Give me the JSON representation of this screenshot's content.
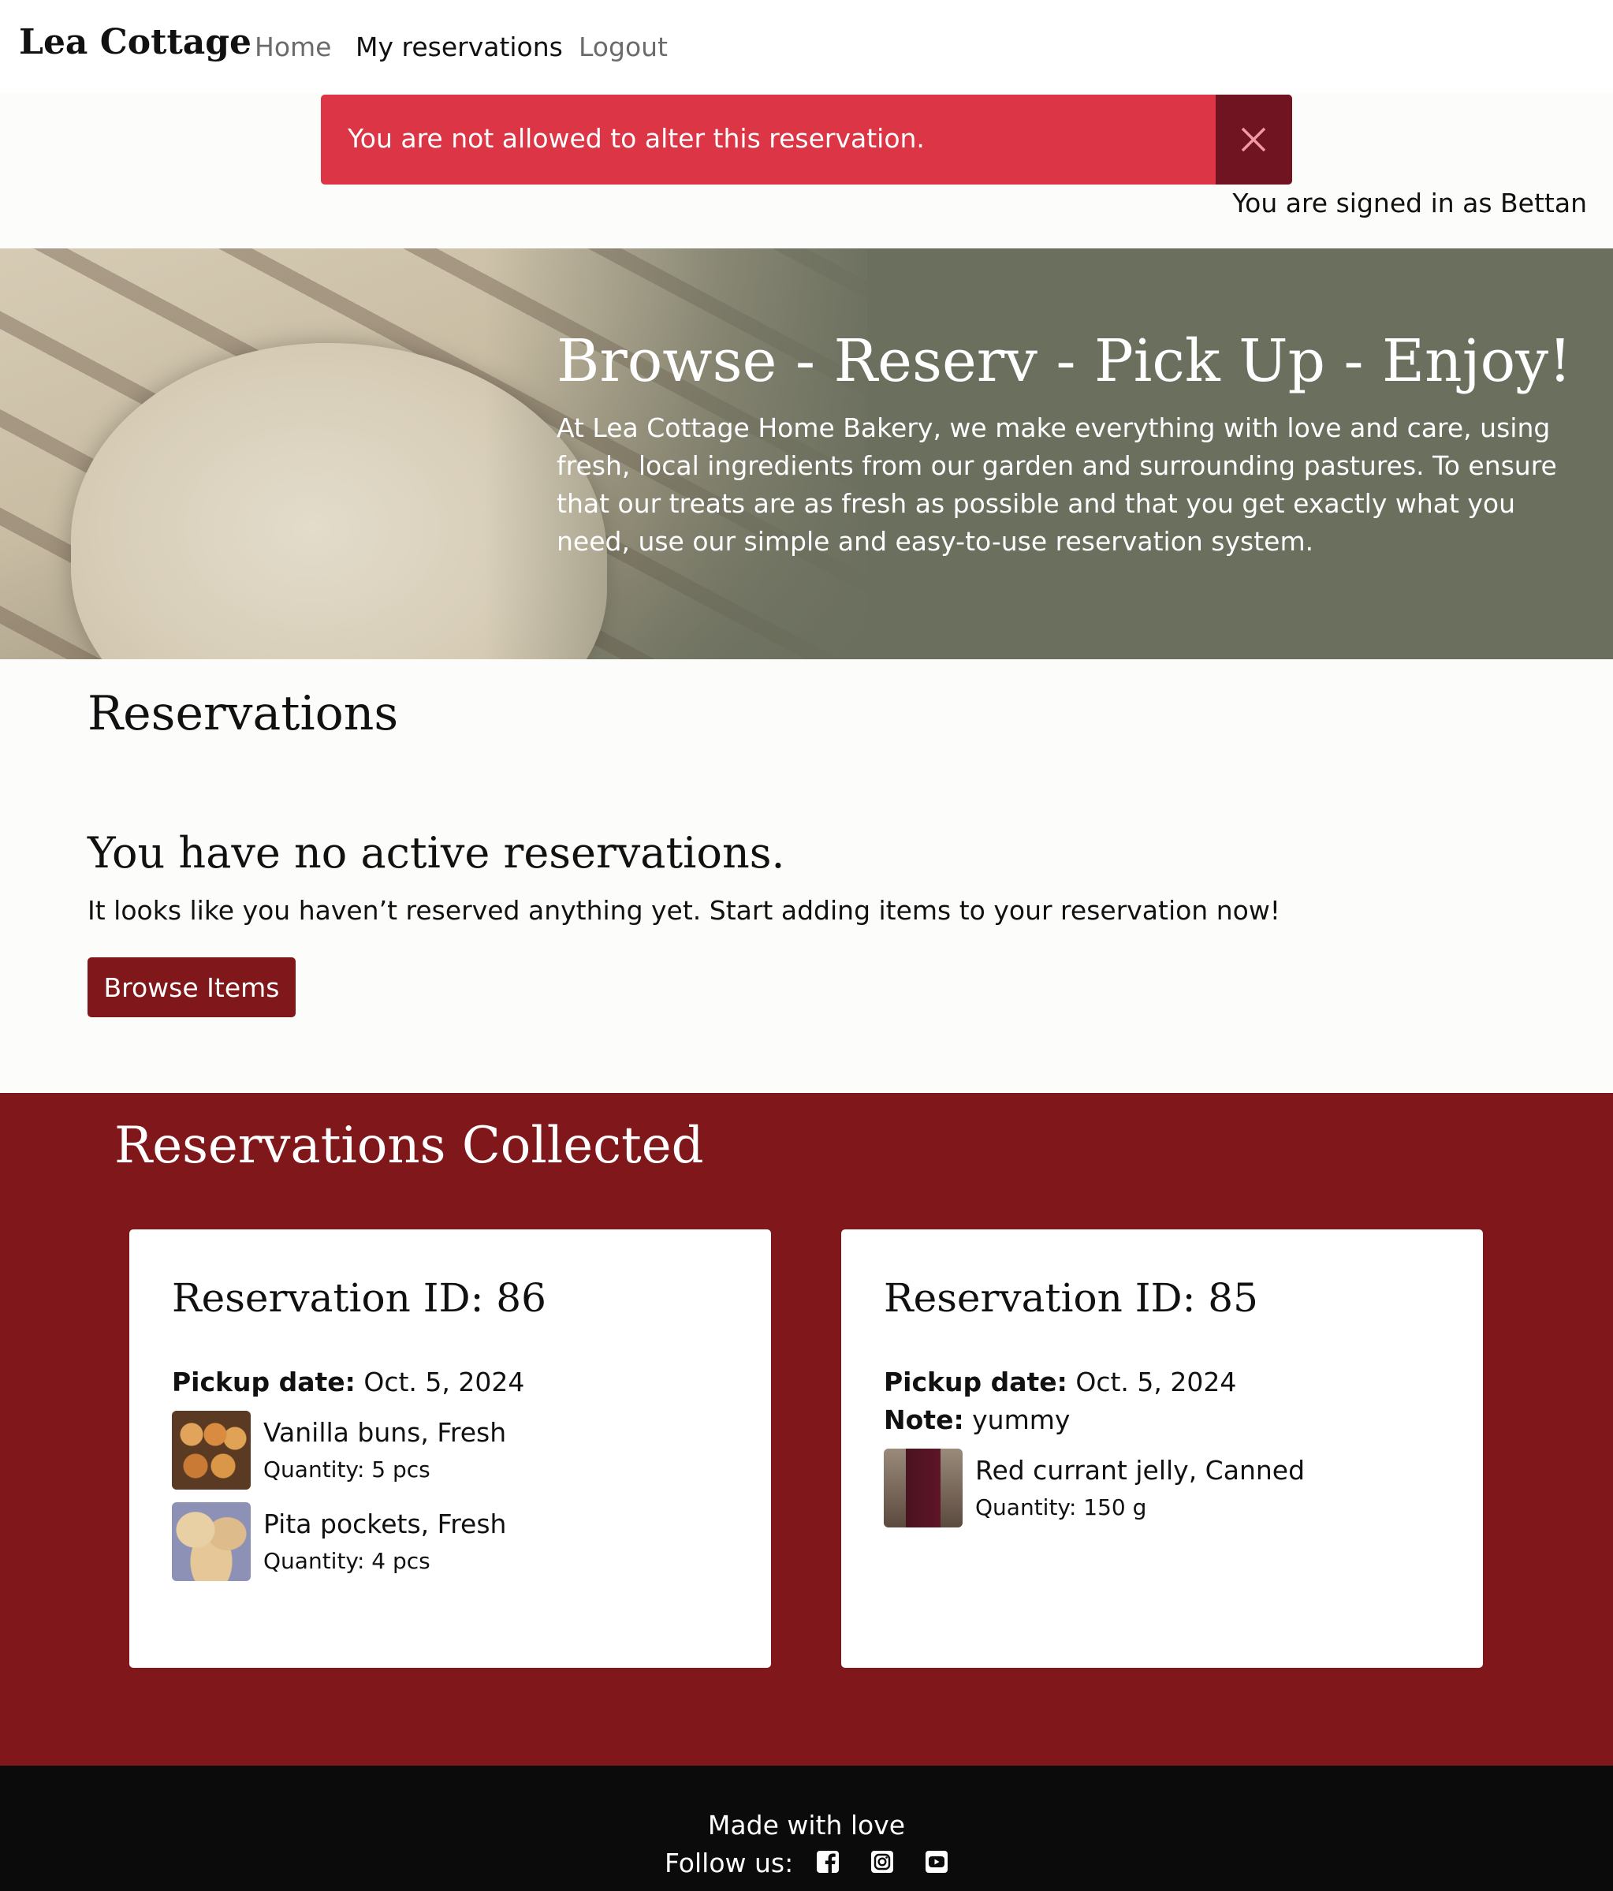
{
  "nav": {
    "brand": "Lea Cottage",
    "links": [
      "Home",
      "My reservations",
      "Logout"
    ]
  },
  "alert": {
    "message": "You are not allowed to alter this reservation.",
    "close_icon": "close-icon",
    "color": "#dc3545"
  },
  "signed_in": "You are signed in as Bettan",
  "hero": {
    "title": "Browse - Reserv - Pick Up - Enjoy!",
    "text": "At Lea Cottage Home Bakery, we make everything with love and care, using fresh, local ingredients from our garden and surrounding pastures. To ensure that our treats are as fresh as possible and that you get exactly what you need, use our simple and easy-to-use reservation system."
  },
  "reservations": {
    "heading": "Reservations",
    "empty_heading": "You have no active reservations.",
    "empty_text": "It looks like you haven’t reserved anything yet. Start adding items to your reservation now!",
    "browse_button": "Browse Items"
  },
  "collected": {
    "title": "Reservations Collected",
    "accent": "#80181b",
    "cards": [
      {
        "title": "Reservation ID: 86",
        "pickup_label": "Pickup date:",
        "pickup_date": "Oct. 5, 2024",
        "items": [
          {
            "name": "Vanilla buns, Fresh",
            "quantity": "Quantity: 5 pcs"
          },
          {
            "name": "Pita pockets, Fresh",
            "quantity": "Quantity: 4 pcs"
          }
        ]
      },
      {
        "title": "Reservation ID: 85",
        "pickup_label": "Pickup date:",
        "pickup_date": "Oct. 5, 2024",
        "note_label": "Note:",
        "note": "yummy",
        "items": [
          {
            "name": "Red currant jelly, Canned",
            "quantity": "Quantity: 150 g"
          }
        ]
      }
    ]
  },
  "footer": {
    "made": "Made with love",
    "follow": "Follow us:",
    "icons": [
      "facebook-icon",
      "instagram-icon",
      "youtube-icon"
    ]
  }
}
